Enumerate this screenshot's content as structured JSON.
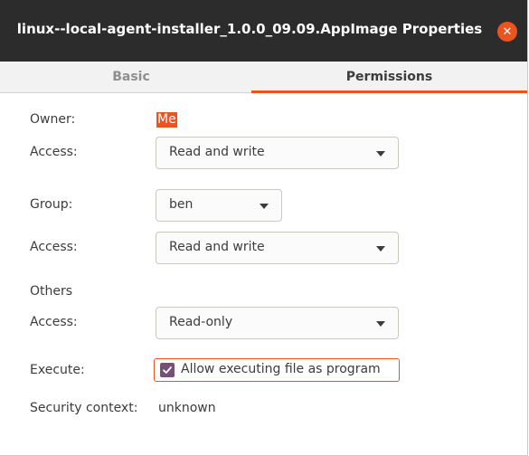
{
  "window": {
    "title": "linux--local-agent-installer_1.0.0_09.09.AppImage Properties",
    "close_icon": "close-icon",
    "accent_color": "#e95420"
  },
  "tabs": [
    {
      "label": "Basic",
      "active": false
    },
    {
      "label": "Permissions",
      "active": true
    }
  ],
  "permissions": {
    "owner_label": "Owner:",
    "owner_value": "Me",
    "owner_access_label": "Access:",
    "owner_access_value": "Read and write",
    "group_label": "Group:",
    "group_value": "ben",
    "group_access_label": "Access:",
    "group_access_value": "Read and write",
    "others_label": "Others",
    "others_access_label": "Access:",
    "others_access_value": "Read-only",
    "execute_label": "Execute:",
    "execute_checkbox_label": "Allow executing file as program",
    "execute_checked": true,
    "security_context_label": "Security context:",
    "security_context_value": "unknown"
  }
}
